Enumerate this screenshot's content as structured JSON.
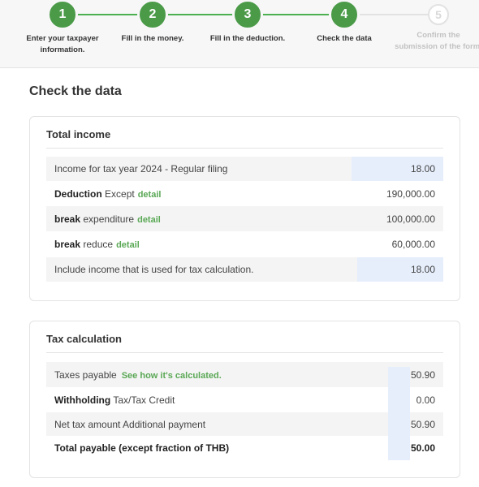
{
  "stepper": {
    "steps": [
      {
        "number": "1",
        "label": "Enter your taxpayer information."
      },
      {
        "number": "2",
        "label": "Fill in the money."
      },
      {
        "number": "3",
        "label": "Fill in the deduction."
      },
      {
        "number": "4",
        "label": "Check the data"
      },
      {
        "number": "5",
        "label": "Confirm the submission of the form."
      }
    ]
  },
  "page": {
    "title": "Check the data"
  },
  "income": {
    "title": "Total income",
    "rows": [
      {
        "label": "Income for tax year 2024 - Regular filing",
        "value": "18.00"
      },
      {
        "label_bold": "Deduction",
        "label": "Except",
        "link": "detail",
        "value": "190,000.00"
      },
      {
        "label_bold": "break",
        "label": "expenditure",
        "link": "detail",
        "value": "100,000.00"
      },
      {
        "label_bold": "break",
        "label": "reduce",
        "link": "detail",
        "value": "60,000.00"
      },
      {
        "label": "Include income that is used for tax calculation.",
        "value": "18.00"
      }
    ]
  },
  "tax": {
    "title": "Tax calculation",
    "rows": [
      {
        "label": "Taxes payable",
        "link": "See how it's calculated.",
        "value": "50.90"
      },
      {
        "label_bold": "Withholding",
        "label": "Tax/Tax Credit",
        "value": "0.00"
      },
      {
        "label": "Net tax amount Additional payment",
        "value": "50.90"
      },
      {
        "label": "Total payable (except fraction of THB)",
        "value": "50.00"
      }
    ]
  },
  "colors": {
    "accent": "#4a9a48",
    "link": "#5aa855",
    "highlight": "#e6eefc"
  }
}
